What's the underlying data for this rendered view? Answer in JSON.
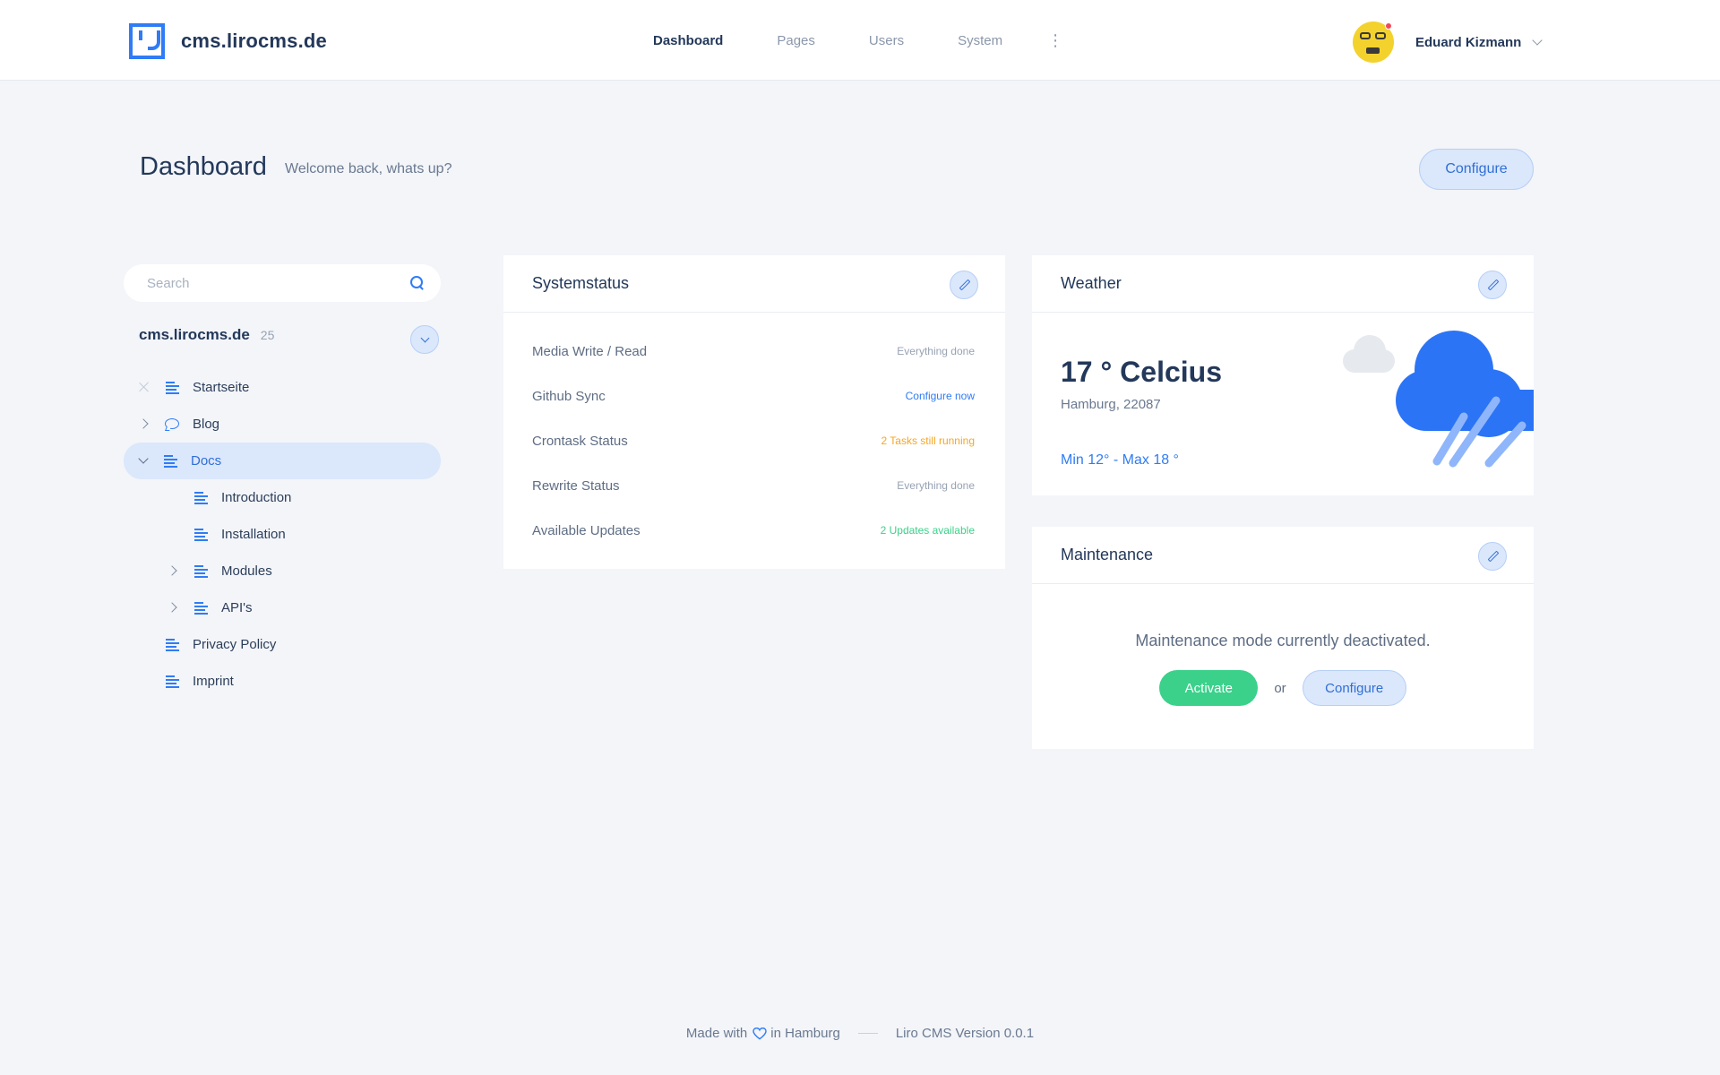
{
  "colors": {
    "accent": "#2f7cf6",
    "success": "#3bd18a",
    "warning": "#f5a623",
    "background": "#f3f5f9"
  },
  "brand": {
    "name": "cms.lirocms.de",
    "logo_icon": "liro-logo-icon"
  },
  "nav": {
    "items": [
      {
        "label": "Dashboard",
        "active": true
      },
      {
        "label": "Pages",
        "active": false
      },
      {
        "label": "Users",
        "active": false
      },
      {
        "label": "System",
        "active": false
      }
    ],
    "more_icon": "⋮"
  },
  "user": {
    "name": "Eduard Kizmann",
    "has_notification": true
  },
  "header": {
    "title": "Dashboard",
    "subtitle": "Welcome back, whats up?",
    "configure_label": "Configure"
  },
  "sidebar": {
    "search_placeholder": "Search",
    "site_name": "cms.lirocms.de",
    "site_count": "25",
    "tree": [
      {
        "label": "Startseite",
        "icon": "document-icon",
        "lead": "close-icon",
        "level": 0,
        "active": false
      },
      {
        "label": "Blog",
        "icon": "chat-icon",
        "lead": "chevron-right-icon",
        "level": 0,
        "active": false
      },
      {
        "label": "Docs",
        "icon": "document-icon",
        "lead": "chevron-down-icon",
        "level": 0,
        "active": true
      },
      {
        "label": "Introduction",
        "icon": "document-icon",
        "lead": "",
        "level": 1,
        "active": false
      },
      {
        "label": "Installation",
        "icon": "document-icon",
        "lead": "",
        "level": 1,
        "active": false
      },
      {
        "label": "Modules",
        "icon": "document-icon",
        "lead": "chevron-right-icon",
        "level": 1,
        "active": false
      },
      {
        "label": "API's",
        "icon": "document-icon",
        "lead": "chevron-right-icon",
        "level": 1,
        "active": false
      },
      {
        "label": "Privacy Policy",
        "icon": "document-icon",
        "lead": "",
        "level": 0,
        "active": false
      },
      {
        "label": "Imprint",
        "icon": "document-icon",
        "lead": "",
        "level": 0,
        "active": false
      }
    ]
  },
  "systemstatus": {
    "title": "Systemstatus",
    "rows": [
      {
        "label": "Media Write / Read",
        "value": "Everything done",
        "color": "#97a2b3"
      },
      {
        "label": "Github Sync",
        "value": "Configure now",
        "color": "#2f7cf6"
      },
      {
        "label": "Crontask Status",
        "value": "2 Tasks still running",
        "color": "#f5a623"
      },
      {
        "label": "Rewrite Status",
        "value": "Everything done",
        "color": "#97a2b3"
      },
      {
        "label": "Available Updates",
        "value": "2 Updates available",
        "color": "#3bd18a"
      }
    ]
  },
  "weather": {
    "title": "Weather",
    "temperature": "17 ° Celcius",
    "location": "Hamburg, 22087",
    "range": "Min 12° - Max 18 °",
    "icon": "rain-cloud-icon"
  },
  "maintenance": {
    "title": "Maintenance",
    "text": "Maintenance mode currently deactivated.",
    "activate_label": "Activate",
    "or_label": "or",
    "configure_label": "Configure"
  },
  "footer": {
    "made_with": "Made with",
    "in_city": "in Hamburg",
    "version": "Liro CMS Version 0.0.1"
  }
}
